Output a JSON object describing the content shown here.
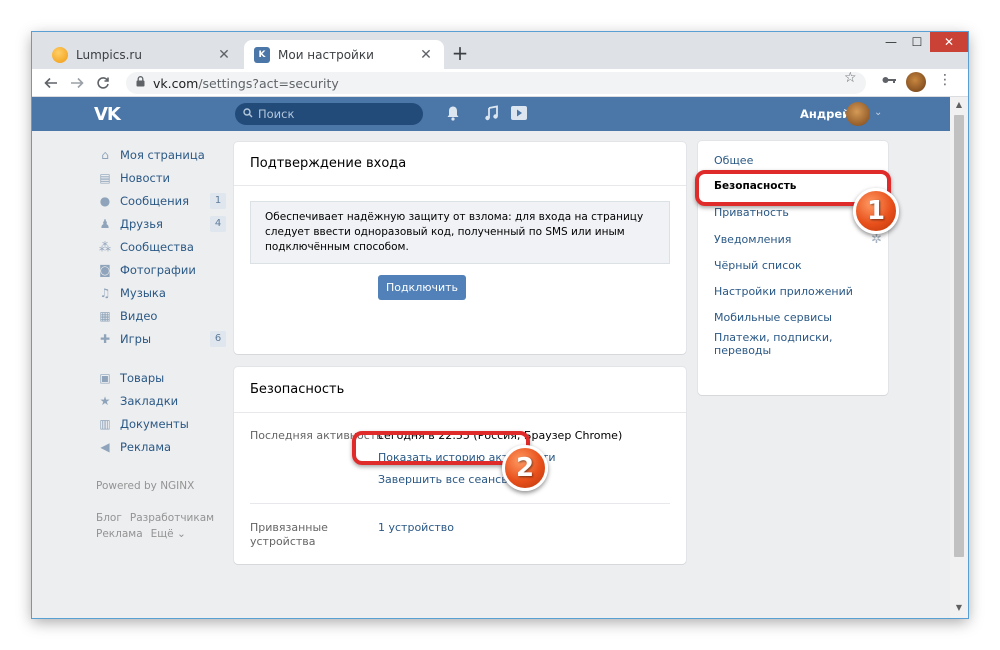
{
  "browser": {
    "tabs": [
      {
        "label": "Lumpics.ru",
        "icon": "lumpics-favicon"
      },
      {
        "label": "Мои настройки",
        "icon": "vk-favicon"
      }
    ],
    "tab_close": "✕",
    "new_tab": "+",
    "url_host": "vk.com",
    "url_path": "/settings?act=security",
    "window_controls": {
      "minimize": "—",
      "maximize": "☐",
      "close": "✕"
    }
  },
  "header": {
    "logo": "VK",
    "search_placeholder": "Поиск",
    "user_name": "Андрей",
    "brand_color": "#4a76a8"
  },
  "left_menu": {
    "items": [
      {
        "label": "Моя страница",
        "icon": "home-icon"
      },
      {
        "label": "Новости",
        "icon": "news-icon"
      },
      {
        "label": "Сообщения",
        "icon": "messages-icon",
        "count": "1"
      },
      {
        "label": "Друзья",
        "icon": "friends-icon",
        "count": "4"
      },
      {
        "label": "Сообщества",
        "icon": "communities-icon"
      },
      {
        "label": "Фотографии",
        "icon": "photos-icon"
      },
      {
        "label": "Музыка",
        "icon": "music-icon"
      },
      {
        "label": "Видео",
        "icon": "video-icon"
      },
      {
        "label": "Игры",
        "icon": "games-icon",
        "count": "6"
      },
      {
        "label": "Товары",
        "icon": "goods-icon"
      },
      {
        "label": "Закладки",
        "icon": "bookmarks-icon"
      },
      {
        "label": "Документы",
        "icon": "documents-icon"
      },
      {
        "label": "Реклама",
        "icon": "ads-icon"
      }
    ],
    "powered_by": "Powered by NGINX",
    "footer": {
      "blog": "Блог",
      "developers": "Разработчикам",
      "ads": "Реклама",
      "more": "Ещё"
    }
  },
  "login_confirm": {
    "title": "Подтверждение входа",
    "notice": "Обеспечивает надёжную защиту от взлома: для входа на страницу следует ввести одноразовый код, полученный по SMS или иным подключённым способом.",
    "button": "Подключить"
  },
  "security": {
    "title": "Безопасность",
    "last_activity_label": "Последняя активность",
    "last_activity_value": "сегодня в 22:55 (Россия, Браузер Chrome)",
    "show_history": "Показать историю активности",
    "end_sessions": "Завершить все сеансы",
    "devices_label": "Привязанные устройства",
    "devices_value": "1 устройство"
  },
  "right_menu": {
    "items": [
      {
        "label": "Общее",
        "active": false
      },
      {
        "label": "Безопасность",
        "active": true
      },
      {
        "label": "Приватность",
        "active": false
      },
      {
        "label": "Уведомления",
        "active": false
      },
      {
        "label": "Чёрный список",
        "active": false
      },
      {
        "label": "Настройки приложений",
        "active": false
      },
      {
        "label": "Мобильные сервисы",
        "active": false
      },
      {
        "label": "Платежи, подписки, переводы",
        "active": false
      }
    ]
  },
  "annotations": {
    "badge1": "1",
    "badge2": "2",
    "color": "#e02b2b"
  }
}
